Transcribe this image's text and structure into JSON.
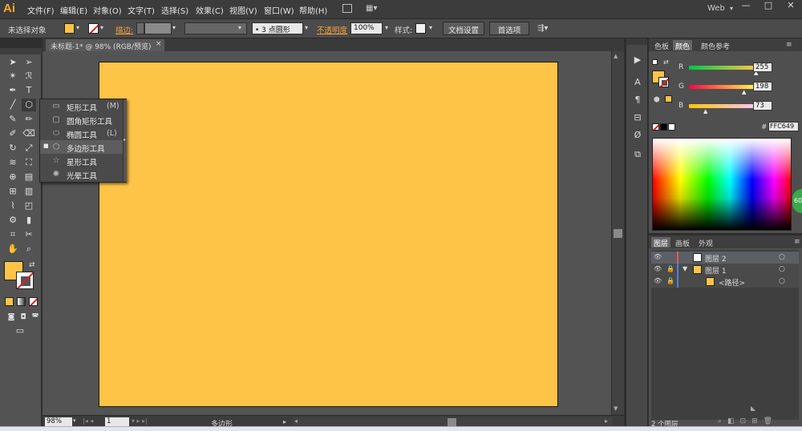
{
  "app": {
    "logo": "Ai",
    "workspace": "Web",
    "window_controls": [
      "—",
      "□",
      "✕"
    ]
  },
  "menubar": {
    "items": [
      "文件(F)",
      "编辑(E)",
      "对象(O)",
      "文字(T)",
      "选择(S)",
      "效果(C)",
      "视图(V)",
      "窗口(W)",
      "帮助(H)"
    ]
  },
  "control_bar": {
    "selection_label": "未选择对象",
    "fill_color": "#fec447",
    "stroke_label": "描边:",
    "stroke_weight": "",
    "brush": "3 点圆形",
    "opacity_label": "不透明度",
    "opacity_value": "100%",
    "style_label": "样式:",
    "doc_setup": "文档设置",
    "preferences": "首选项"
  },
  "document": {
    "tab_title": "未标题-1* @ 98% (RGB/预览)",
    "close": "×",
    "artboard_color": "#fec447"
  },
  "flyout": {
    "items": [
      {
        "label": "矩形工具",
        "shortcut": "(M)",
        "icon": "rectangle-icon",
        "glyph": "▭"
      },
      {
        "label": "圆角矩形工具",
        "shortcut": "",
        "icon": "rounded-rectangle-icon",
        "glyph": "▢"
      },
      {
        "label": "椭圆工具",
        "shortcut": "(L)",
        "icon": "ellipse-icon",
        "glyph": "⬭"
      },
      {
        "label": "多边形工具",
        "shortcut": "",
        "icon": "polygon-icon",
        "glyph": "⬡",
        "active": true
      },
      {
        "label": "星形工具",
        "shortcut": "",
        "icon": "star-icon",
        "glyph": "☆"
      },
      {
        "label": "光晕工具",
        "shortcut": "",
        "icon": "flare-icon",
        "glyph": "✺"
      }
    ]
  },
  "status_bar": {
    "zoom": "98%",
    "page": "1",
    "tool": "多边形"
  },
  "color_panel": {
    "tabs": [
      "色板",
      "颜色",
      "颜色参考"
    ],
    "active_tab": "颜色",
    "channels": [
      {
        "label": "R",
        "value": "255"
      },
      {
        "label": "G",
        "value": "198"
      },
      {
        "label": "B",
        "value": "73"
      }
    ],
    "hex_label": "#",
    "hex_value": "FFC649",
    "badge": "60"
  },
  "layers_panel": {
    "tabs": [
      "图层",
      "画板",
      "外观"
    ],
    "active_tab": "图层",
    "rows": [
      {
        "name": "图层 2",
        "color": "#e05a5a",
        "thumb": "#ffffff"
      },
      {
        "name": "图层 1",
        "color": "#4a7fe0",
        "thumb": "#fec447"
      },
      {
        "name": "<路径>",
        "color": "#4a7fe0",
        "thumb": "#fec447"
      }
    ],
    "count": "2 个图层"
  }
}
